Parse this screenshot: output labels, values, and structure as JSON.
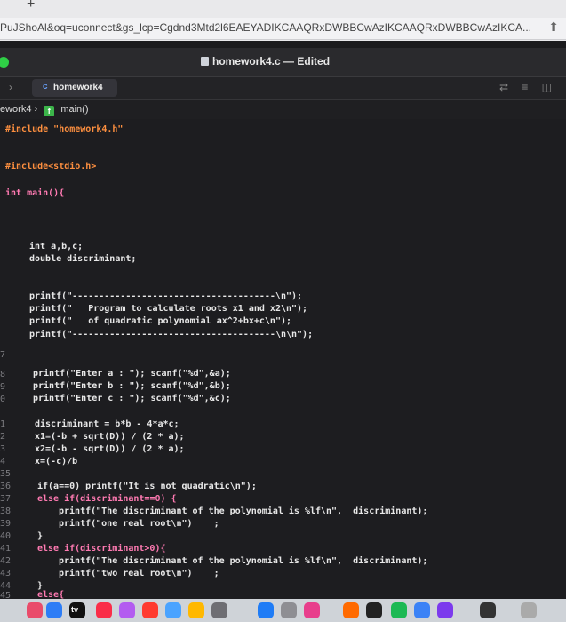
{
  "browser": {
    "new_tab": "+",
    "url": "PuJShoAl&oq=uconnect&gs_lcp=Cgdnd3Mtd2l6EAEYADIKCAAQRxDWBBCwAzIKCAAQRxDWBBCwAzIKCA..."
  },
  "xcode": {
    "window_title": "homework4.c — Edited",
    "tab_label": "homework4",
    "tab_icon": "c-file-icon",
    "jump_bar_project": "ework4",
    "jump_bar_function": "main()",
    "jump_bar_badge": "f"
  },
  "code": {
    "line_include_hw": "#include \"homework4.h\"",
    "line_include_stdio": "#include<stdio.h>",
    "line_main": "int main(){",
    "line_decl_ints": "int a,b,c;",
    "line_decl_double": "double discriminant;",
    "line_p1": "printf(\"--------------------------------------\\n\");",
    "line_p2": "printf(\"   Program to calculate roots x1 and x2\\n\");",
    "line_p3": "printf(\"   of quadratic polynomial ax^2+bx+c\\n\");",
    "line_p4": "printf(\"--------------------------------------\\n\\n\");",
    "line_in_a": "printf(\"Enter a : \"); scanf(\"%d\",&a);",
    "line_in_b": "printf(\"Enter b : \"); scanf(\"%d\",&b);",
    "line_in_c": "printf(\"Enter c : \"); scanf(\"%d\",&c);",
    "line_disc": "discriminant = b*b - 4*a*c;",
    "line_x1": "x1=(-b + sqrt(D)) / (2 * a);",
    "line_x2": "x2=(-b - sqrt(D)) / (2 * a);",
    "line_x": "x=(-c)/b",
    "line_if": "if(a==0) printf(\"It is not quadratic\\n\");",
    "line_elseif1": "else if(discriminant==0) {",
    "line_pr1": "printf(\"The discriminant of the polynomial is %lf\\n\",  discriminant);",
    "line_pr2": "printf(\"one real root\\n\")    ;",
    "line_close1": "}",
    "line_elseif2": "else if(discriminant>0){",
    "line_pr3": "printf(\"The discriminant of the polynomial is %lf\\n\",  discriminant);",
    "line_pr4": "printf(\"two real root\\n\")    ;",
    "line_close2": "}",
    "line_else": "else{"
  },
  "line_numbers": [
    "7",
    "8",
    "9",
    "0",
    "1",
    "2",
    "3",
    "4",
    "35",
    "36",
    "37",
    "38",
    "39",
    "40",
    "41",
    "42",
    "43",
    "44",
    "45"
  ],
  "dock": {
    "app_tv": "tv"
  }
}
